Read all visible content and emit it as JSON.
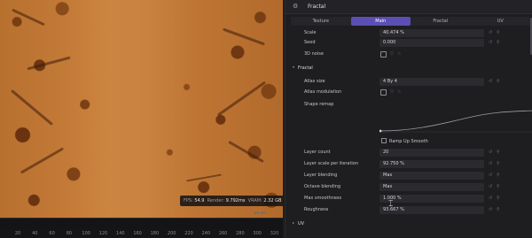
{
  "viewport": {
    "fps_label": "FPS:",
    "fps": "54.9",
    "render_label": "Render:",
    "render": "9.792ms",
    "vram_label": "VRAM:",
    "vram": "2.32 GB"
  },
  "timeline": {
    "ticks": [
      "20",
      "40",
      "60",
      "80",
      "100",
      "120",
      "140",
      "160",
      "180",
      "200",
      "220",
      "240",
      "260",
      "280",
      "300",
      "320",
      "340"
    ]
  },
  "panel": {
    "title": "Fractal",
    "header_icon": "gear-icon",
    "tabs": [
      {
        "label": "Texture",
        "active": false
      },
      {
        "label": "Main",
        "active": true
      },
      {
        "label": "Fractal",
        "active": false
      },
      {
        "label": "UV",
        "active": false
      }
    ],
    "main_rows": [
      {
        "label": "Scale",
        "value": "40.474 %",
        "kind": "field"
      },
      {
        "label": "Seed",
        "value": "0.000",
        "kind": "field"
      },
      {
        "label": "3D noise",
        "value": "",
        "kind": "checkbox"
      }
    ],
    "fractal_section": "Fractal",
    "fractal_rows_top": [
      {
        "label": "Atlas size",
        "value": "4 By 4",
        "kind": "field"
      },
      {
        "label": "Atlas modulation",
        "value": "",
        "kind": "checkbox"
      },
      {
        "label": "Shape remap",
        "value": "",
        "kind": "curve"
      }
    ],
    "ramp_label": "Ramp Up Smooth",
    "fractal_rows_bottom": [
      {
        "label": "Layer count",
        "value": "20",
        "kind": "field"
      },
      {
        "label": "Layer scale per iteration",
        "value": "92.750 %",
        "kind": "field"
      },
      {
        "label": "Layer blending",
        "value": "Max",
        "kind": "field"
      },
      {
        "label": "Octave blending",
        "value": "Max",
        "kind": "field"
      },
      {
        "label": "Max smoothness",
        "value": "1.000 %",
        "kind": "field"
      },
      {
        "label": "Roughness",
        "value": "93.667 %",
        "kind": "field"
      }
    ],
    "uv_section": "UV"
  },
  "colors": {
    "accent": "#5b4fb3",
    "panel_bg": "#1e1e21",
    "terrain": "#c47b38"
  }
}
